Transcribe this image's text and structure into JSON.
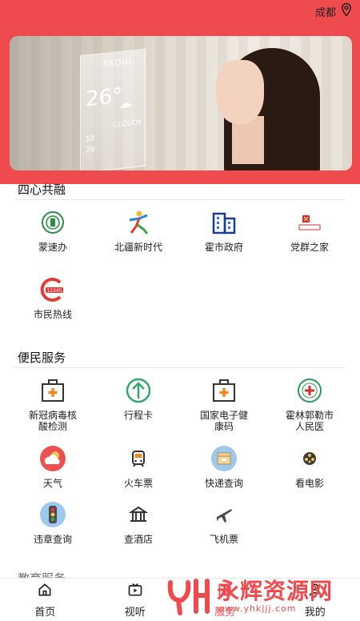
{
  "header": {
    "city": "成都"
  },
  "banner": {
    "weather_city": "SEOUL",
    "weather_temp": "26°",
    "weather_low": "18",
    "weather_high": "29",
    "weather_cond": "CLOUDY"
  },
  "section_sixin": {
    "title": "四心共融",
    "items": [
      {
        "label": "蒙速办",
        "icon": "emblem-icon"
      },
      {
        "label": "北疆新时代",
        "icon": "figure-icon"
      },
      {
        "label": "霍市政府",
        "icon": "building-icon"
      },
      {
        "label": "党群之家",
        "icon": "party-icon"
      },
      {
        "label": "市民热线",
        "icon": "hotline-icon"
      }
    ]
  },
  "section_bianmin": {
    "title": "便民服务",
    "items": [
      {
        "label": "新冠病毒核酸检测",
        "icon": "medical-kit-icon"
      },
      {
        "label": "行程卡",
        "icon": "arrow-up-circle-icon"
      },
      {
        "label": "国家电子健康码",
        "icon": "medical-kit-icon"
      },
      {
        "label": "霍林郭勒市人民医",
        "icon": "hospital-icon"
      },
      {
        "label": "天气",
        "icon": "weather-icon"
      },
      {
        "label": "火车票",
        "icon": "train-icon"
      },
      {
        "label": "快递查询",
        "icon": "package-icon"
      },
      {
        "label": "看电影",
        "icon": "film-icon"
      },
      {
        "label": "违章查询",
        "icon": "traffic-light-icon"
      },
      {
        "label": "查酒店",
        "icon": "hotel-icon"
      },
      {
        "label": "飞机票",
        "icon": "plane-icon"
      }
    ]
  },
  "partial_section": {
    "title": "教育服务"
  },
  "bottom_nav": [
    {
      "label": "首页",
      "icon": "home-icon"
    },
    {
      "label": "视听",
      "icon": "tv-icon"
    },
    {
      "label": "服务",
      "icon": "service-icon"
    },
    {
      "label": "我的",
      "icon": "user-icon"
    }
  ],
  "watermark": {
    "main": "永辉资源网",
    "sub": "www.yhkjjj.com"
  },
  "colors": {
    "accent": "#ef4b4e",
    "divider": "#e6e6e6"
  }
}
